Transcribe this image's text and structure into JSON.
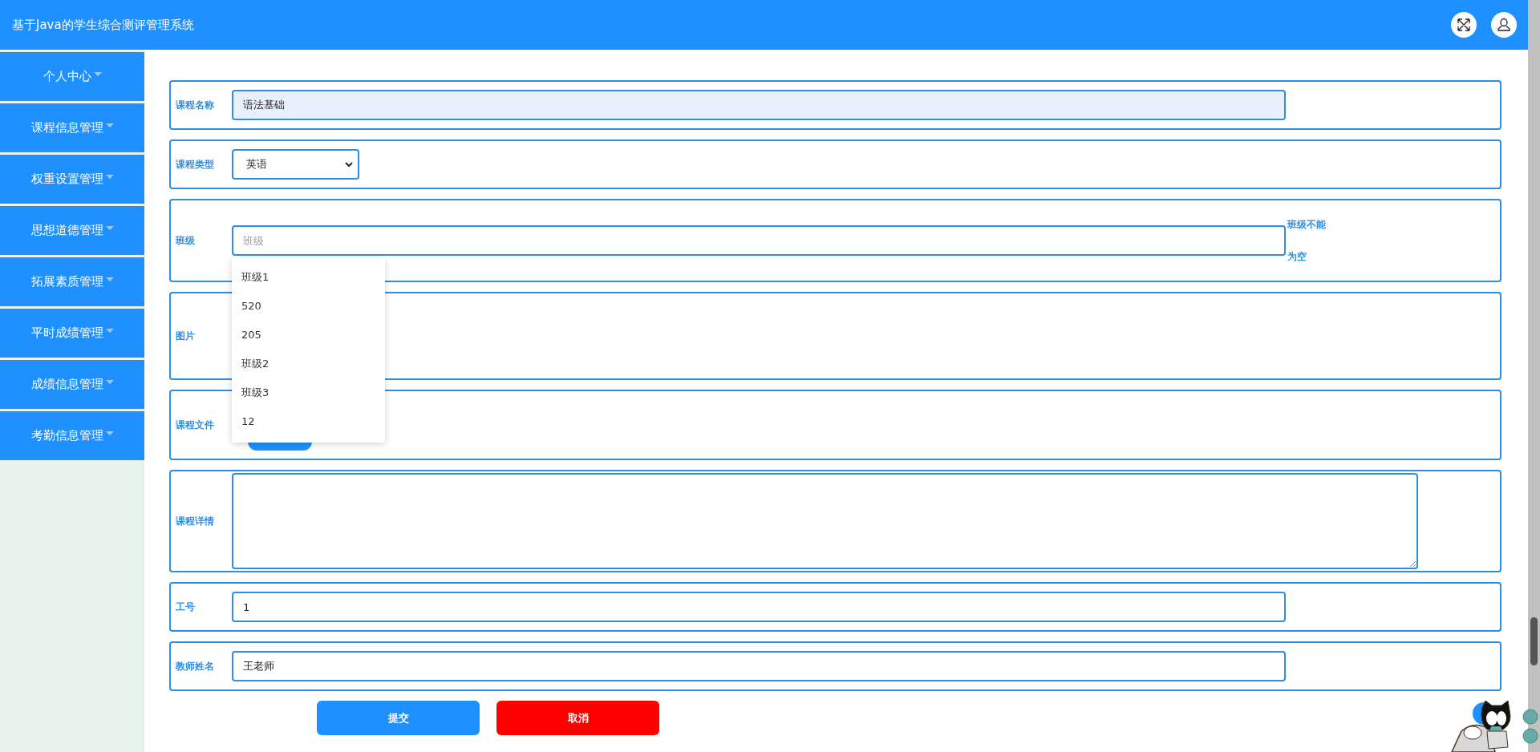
{
  "header": {
    "title": "基于Java的学生综合测评管理系统"
  },
  "sidebar": {
    "items": [
      {
        "label": "个人中心"
      },
      {
        "label": "课程信息管理"
      },
      {
        "label": "权重设置管理"
      },
      {
        "label": "思想道德管理"
      },
      {
        "label": "拓展素质管理"
      },
      {
        "label": "平时成绩管理"
      },
      {
        "label": "成绩信息管理"
      },
      {
        "label": "考勤信息管理"
      }
    ]
  },
  "form": {
    "fields": [
      {
        "kind": "text",
        "label": "课程名称",
        "value": "语法基础",
        "autofilled": true
      },
      {
        "kind": "select",
        "label": "课程类型",
        "value": "英语"
      },
      {
        "kind": "text",
        "label": "班级",
        "placeholder": "班级",
        "autofilled": false,
        "error": "班级不能为空",
        "options": [
          "班级1",
          "520",
          "205",
          "班级2",
          "班级3",
          "12"
        ]
      },
      {
        "kind": "image",
        "label": "图片"
      },
      {
        "kind": "file",
        "label": "课程文件"
      },
      {
        "kind": "textarea",
        "label": "课程详情"
      },
      {
        "kind": "text",
        "label": "工号",
        "value": "1",
        "autofilled": false
      },
      {
        "kind": "text",
        "label": "教师姓名",
        "value": "王老师",
        "autofilled": false
      }
    ],
    "buttons": [
      {
        "kind": "primary",
        "label": "提交"
      },
      {
        "kind": "danger",
        "label": "取消"
      }
    ]
  }
}
